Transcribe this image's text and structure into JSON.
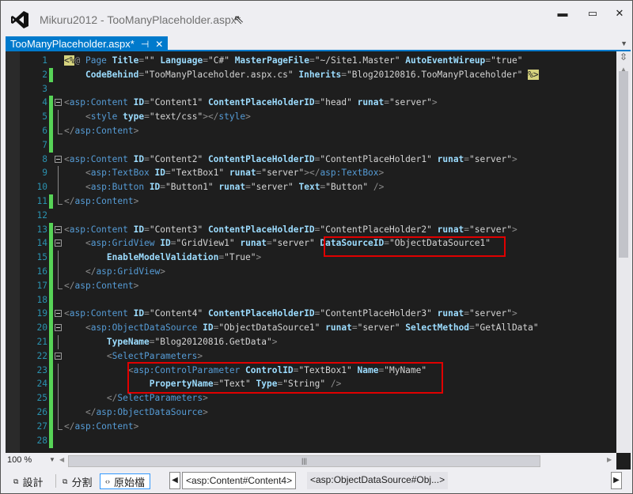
{
  "window": {
    "title": "Mikuru2012 - TooManyPlaceholder.aspx*"
  },
  "tab": {
    "label": "TooManyPlaceholder.aspx*",
    "pin": "⊣",
    "close": "✕"
  },
  "code": {
    "lines": [
      {
        "n": "1",
        "chg": false,
        "fold": "",
        "tokens": [
          [
            "h",
            "<%"
          ],
          [
            "d",
            "@ "
          ],
          [
            "t",
            "Page"
          ],
          [
            "s",
            " "
          ],
          [
            "a",
            "Title"
          ],
          [
            "d",
            "="
          ],
          [
            "s",
            "\"\""
          ],
          [
            "s",
            " "
          ],
          [
            "a",
            "Language"
          ],
          [
            "d",
            "="
          ],
          [
            "s",
            "\"C#\""
          ],
          [
            "s",
            " "
          ],
          [
            "a",
            "MasterPageFile"
          ],
          [
            "d",
            "="
          ],
          [
            "s",
            "\"~/Site1.Master\""
          ],
          [
            "s",
            " "
          ],
          [
            "a",
            "AutoEventWireup"
          ],
          [
            "d",
            "="
          ],
          [
            "s",
            "\"true\""
          ]
        ]
      },
      {
        "n": "2",
        "chg": true,
        "fold": "",
        "tokens": [
          [
            "s",
            "    "
          ],
          [
            "a",
            "CodeBehind"
          ],
          [
            "d",
            "="
          ],
          [
            "s",
            "\"TooManyPlaceholder.aspx.cs\""
          ],
          [
            "s",
            " "
          ],
          [
            "a",
            "Inherits"
          ],
          [
            "d",
            "="
          ],
          [
            "s",
            "\"Blog20120816.TooManyPlaceholder\""
          ],
          [
            "s",
            " "
          ],
          [
            "h",
            "%>"
          ]
        ]
      },
      {
        "n": "3",
        "chg": false,
        "fold": "",
        "tokens": []
      },
      {
        "n": "4",
        "chg": true,
        "fold": "open",
        "tokens": [
          [
            "d",
            "<"
          ],
          [
            "t",
            "asp:Content"
          ],
          [
            "s",
            " "
          ],
          [
            "a",
            "ID"
          ],
          [
            "d",
            "="
          ],
          [
            "s",
            "\"Content1\""
          ],
          [
            "s",
            " "
          ],
          [
            "a",
            "ContentPlaceHolderID"
          ],
          [
            "d",
            "="
          ],
          [
            "s",
            "\"head\""
          ],
          [
            "s",
            " "
          ],
          [
            "a",
            "runat"
          ],
          [
            "d",
            "="
          ],
          [
            "s",
            "\"server\""
          ],
          [
            "d",
            ">"
          ]
        ]
      },
      {
        "n": "5",
        "chg": true,
        "fold": "line",
        "tokens": [
          [
            "s",
            "    "
          ],
          [
            "d",
            "<"
          ],
          [
            "t",
            "style"
          ],
          [
            "s",
            " "
          ],
          [
            "a",
            "type"
          ],
          [
            "d",
            "="
          ],
          [
            "s",
            "\"text/css\""
          ],
          [
            "d",
            "></"
          ],
          [
            "t",
            "style"
          ],
          [
            "d",
            ">"
          ]
        ]
      },
      {
        "n": "6",
        "chg": true,
        "fold": "end",
        "tokens": [
          [
            "d",
            "</"
          ],
          [
            "t",
            "asp:Content"
          ],
          [
            "d",
            ">"
          ]
        ]
      },
      {
        "n": "7",
        "chg": true,
        "fold": "",
        "tokens": []
      },
      {
        "n": "8",
        "chg": false,
        "fold": "open",
        "tokens": [
          [
            "d",
            "<"
          ],
          [
            "t",
            "asp:Content"
          ],
          [
            "s",
            " "
          ],
          [
            "a",
            "ID"
          ],
          [
            "d",
            "="
          ],
          [
            "s",
            "\"Content2\""
          ],
          [
            "s",
            " "
          ],
          [
            "a",
            "ContentPlaceHolderID"
          ],
          [
            "d",
            "="
          ],
          [
            "s",
            "\"ContentPlaceHolder1\""
          ],
          [
            "s",
            " "
          ],
          [
            "a",
            "runat"
          ],
          [
            "d",
            "="
          ],
          [
            "s",
            "\"server\""
          ],
          [
            "d",
            ">"
          ]
        ]
      },
      {
        "n": "9",
        "chg": false,
        "fold": "line",
        "tokens": [
          [
            "s",
            "    "
          ],
          [
            "d",
            "<"
          ],
          [
            "t",
            "asp:TextBox"
          ],
          [
            "s",
            " "
          ],
          [
            "a",
            "ID"
          ],
          [
            "d",
            "="
          ],
          [
            "s",
            "\"TextBox1\""
          ],
          [
            "s",
            " "
          ],
          [
            "a",
            "runat"
          ],
          [
            "d",
            "="
          ],
          [
            "s",
            "\"server\""
          ],
          [
            "d",
            "></"
          ],
          [
            "t",
            "asp:TextBox"
          ],
          [
            "d",
            ">"
          ]
        ]
      },
      {
        "n": "10",
        "chg": false,
        "fold": "line",
        "tokens": [
          [
            "s",
            "    "
          ],
          [
            "d",
            "<"
          ],
          [
            "t",
            "asp:Button"
          ],
          [
            "s",
            " "
          ],
          [
            "a",
            "ID"
          ],
          [
            "d",
            "="
          ],
          [
            "s",
            "\"Button1\""
          ],
          [
            "s",
            " "
          ],
          [
            "a",
            "runat"
          ],
          [
            "d",
            "="
          ],
          [
            "s",
            "\"server\""
          ],
          [
            "s",
            " "
          ],
          [
            "a",
            "Text"
          ],
          [
            "d",
            "="
          ],
          [
            "s",
            "\"Button\""
          ],
          [
            "s",
            " "
          ],
          [
            "d",
            "/>"
          ]
        ]
      },
      {
        "n": "11",
        "chg": true,
        "fold": "end",
        "tokens": [
          [
            "d",
            "</"
          ],
          [
            "t",
            "asp:Content"
          ],
          [
            "d",
            ">"
          ]
        ]
      },
      {
        "n": "12",
        "chg": false,
        "fold": "",
        "tokens": []
      },
      {
        "n": "13",
        "chg": true,
        "fold": "open",
        "tokens": [
          [
            "d",
            "<"
          ],
          [
            "t",
            "asp:Content"
          ],
          [
            "s",
            " "
          ],
          [
            "a",
            "ID"
          ],
          [
            "d",
            "="
          ],
          [
            "s",
            "\"Content3\""
          ],
          [
            "s",
            " "
          ],
          [
            "a",
            "ContentPlaceHolderID"
          ],
          [
            "d",
            "="
          ],
          [
            "s",
            "\"ContentPlaceHolder2\""
          ],
          [
            "s",
            " "
          ],
          [
            "a",
            "runat"
          ],
          [
            "d",
            "="
          ],
          [
            "s",
            "\"server\""
          ],
          [
            "d",
            ">"
          ]
        ]
      },
      {
        "n": "14",
        "chg": true,
        "fold": "open",
        "tokens": [
          [
            "s",
            "    "
          ],
          [
            "d",
            "<"
          ],
          [
            "t",
            "asp:GridView"
          ],
          [
            "s",
            " "
          ],
          [
            "a",
            "ID"
          ],
          [
            "d",
            "="
          ],
          [
            "s",
            "\"GridView1\""
          ],
          [
            "s",
            " "
          ],
          [
            "a",
            "runat"
          ],
          [
            "d",
            "="
          ],
          [
            "s",
            "\"server\""
          ],
          [
            "s",
            " "
          ],
          [
            "a",
            "DataSourceID"
          ],
          [
            "d",
            "="
          ],
          [
            "s",
            "\"ObjectDataSource1\""
          ]
        ]
      },
      {
        "n": "15",
        "chg": true,
        "fold": "line",
        "tokens": [
          [
            "s",
            "        "
          ],
          [
            "a",
            "EnableModelValidation"
          ],
          [
            "d",
            "="
          ],
          [
            "s",
            "\"True\""
          ],
          [
            "d",
            ">"
          ]
        ]
      },
      {
        "n": "16",
        "chg": true,
        "fold": "line",
        "tokens": [
          [
            "s",
            "    "
          ],
          [
            "d",
            "</"
          ],
          [
            "t",
            "asp:GridView"
          ],
          [
            "d",
            ">"
          ]
        ]
      },
      {
        "n": "17",
        "chg": true,
        "fold": "end",
        "tokens": [
          [
            "d",
            "</"
          ],
          [
            "t",
            "asp:Content"
          ],
          [
            "d",
            ">"
          ]
        ]
      },
      {
        "n": "18",
        "chg": true,
        "fold": "",
        "tokens": []
      },
      {
        "n": "19",
        "chg": true,
        "fold": "open",
        "tokens": [
          [
            "d",
            "<"
          ],
          [
            "t",
            "asp:Content"
          ],
          [
            "s",
            " "
          ],
          [
            "a",
            "ID"
          ],
          [
            "d",
            "="
          ],
          [
            "s",
            "\"Content4\""
          ],
          [
            "s",
            " "
          ],
          [
            "a",
            "ContentPlaceHolderID"
          ],
          [
            "d",
            "="
          ],
          [
            "s",
            "\"ContentPlaceHolder3\""
          ],
          [
            "s",
            " "
          ],
          [
            "a",
            "runat"
          ],
          [
            "d",
            "="
          ],
          [
            "s",
            "\"server\""
          ],
          [
            "d",
            ">"
          ]
        ]
      },
      {
        "n": "20",
        "chg": true,
        "fold": "open",
        "tokens": [
          [
            "s",
            "    "
          ],
          [
            "d",
            "<"
          ],
          [
            "t",
            "asp:ObjectDataSource"
          ],
          [
            "s",
            " "
          ],
          [
            "a",
            "ID"
          ],
          [
            "d",
            "="
          ],
          [
            "s",
            "\"ObjectDataSource1\""
          ],
          [
            "s",
            " "
          ],
          [
            "a",
            "runat"
          ],
          [
            "d",
            "="
          ],
          [
            "s",
            "\"server\""
          ],
          [
            "s",
            " "
          ],
          [
            "a",
            "SelectMethod"
          ],
          [
            "d",
            "="
          ],
          [
            "s",
            "\"GetAllData\""
          ]
        ]
      },
      {
        "n": "21",
        "chg": true,
        "fold": "line",
        "tokens": [
          [
            "s",
            "        "
          ],
          [
            "a",
            "TypeName"
          ],
          [
            "d",
            "="
          ],
          [
            "s",
            "\"Blog20120816.GetData\""
          ],
          [
            "d",
            ">"
          ]
        ]
      },
      {
        "n": "22",
        "chg": true,
        "fold": "open",
        "tokens": [
          [
            "s",
            "        "
          ],
          [
            "d",
            "<"
          ],
          [
            "t",
            "SelectParameters"
          ],
          [
            "d",
            ">"
          ]
        ]
      },
      {
        "n": "23",
        "chg": true,
        "fold": "line",
        "tokens": [
          [
            "s",
            "            "
          ],
          [
            "d",
            "<"
          ],
          [
            "t",
            "asp:ControlParameter"
          ],
          [
            "s",
            " "
          ],
          [
            "a",
            "ControlID"
          ],
          [
            "d",
            "="
          ],
          [
            "s",
            "\"TextBox1\""
          ],
          [
            "s",
            " "
          ],
          [
            "a",
            "Name"
          ],
          [
            "d",
            "="
          ],
          [
            "s",
            "\"MyName\""
          ]
        ]
      },
      {
        "n": "24",
        "chg": true,
        "fold": "line",
        "tokens": [
          [
            "s",
            "                "
          ],
          [
            "a",
            "PropertyName"
          ],
          [
            "d",
            "="
          ],
          [
            "s",
            "\"Text\""
          ],
          [
            "s",
            " "
          ],
          [
            "a",
            "Type"
          ],
          [
            "d",
            "="
          ],
          [
            "s",
            "\"String\""
          ],
          [
            "s",
            " "
          ],
          [
            "d",
            "/>"
          ]
        ]
      },
      {
        "n": "25",
        "chg": true,
        "fold": "line",
        "tokens": [
          [
            "s",
            "        "
          ],
          [
            "d",
            "</"
          ],
          [
            "t",
            "SelectParameters"
          ],
          [
            "d",
            ">"
          ]
        ]
      },
      {
        "n": "26",
        "chg": true,
        "fold": "line",
        "tokens": [
          [
            "s",
            "    "
          ],
          [
            "d",
            "</"
          ],
          [
            "t",
            "asp:ObjectDataSource"
          ],
          [
            "d",
            ">"
          ]
        ]
      },
      {
        "n": "27",
        "chg": true,
        "fold": "end",
        "tokens": [
          [
            "d",
            "</"
          ],
          [
            "t",
            "asp:Content"
          ],
          [
            "d",
            ">"
          ]
        ]
      },
      {
        "n": "28",
        "chg": true,
        "fold": "",
        "tokens": []
      }
    ]
  },
  "statusbar": {
    "zoom": "100 %",
    "views": [
      {
        "label": "設計",
        "icon": "⧉"
      },
      {
        "label": "分割",
        "icon": "⧉"
      },
      {
        "label": "原始檔",
        "icon": "‹›"
      }
    ],
    "breadcrumbs": [
      "<asp:Content#Content4>",
      "<asp:ObjectDataSource#Obj...>"
    ]
  },
  "colors": {
    "accent": "#007acc",
    "highlight_box": "#e00000",
    "change_bar": "#57d357"
  }
}
